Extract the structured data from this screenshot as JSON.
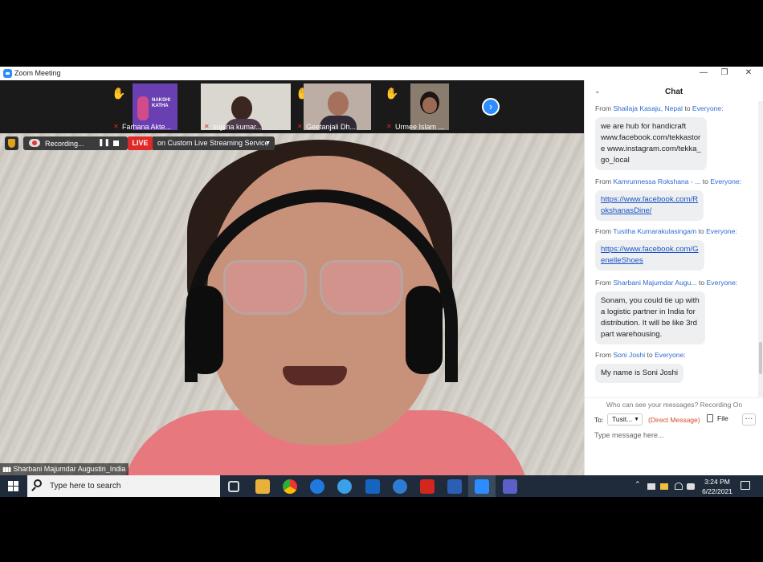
{
  "window": {
    "title": "Zoom Meeting",
    "minimize": "—",
    "restore": "❐",
    "close": "✕"
  },
  "participants": [
    {
      "name": "Farhana Akte...",
      "hand": "✋",
      "thumb_color": "#6a3fb2"
    },
    {
      "name": "sujana kumar...",
      "hand": "✋",
      "thumb_color": "#dad6d0"
    },
    {
      "name": "Geetanjali Dh...",
      "hand": "✋",
      "thumb_color": "#bcaea5"
    },
    {
      "name": "Urmee Islam ...",
      "hand": "✋",
      "thumb_color": "#8a7d70"
    }
  ],
  "participant_thumb_text": [
    "NAKSHI",
    "KATHA"
  ],
  "next_label": "›",
  "recording": {
    "label": "Recording...",
    "pause": "❚❚"
  },
  "live": {
    "badge": "LIVE",
    "service": "on Custom Live Streaming Service",
    "caret": "▼"
  },
  "speaker": {
    "name": "Sharbani Majumdar Augustin_India",
    "signal": "▮▮▮"
  },
  "chat": {
    "title": "Chat",
    "collapse": "⌄",
    "messages": [
      {
        "from": "Shailaja Kasaju, Nepal",
        "to": "Everyone:",
        "lines": [
          "we are hub for handicraft",
          "www.facebook.com/tekkastor",
          "e www.instagram.com/tekka_",
          "go_local"
        ],
        "link": false
      },
      {
        "from": "Kamrunnessa Rokshana - ...",
        "to": "Everyone:",
        "lines": [
          "https://www.facebook.com/R",
          "okshanasDine/"
        ],
        "link": true
      },
      {
        "from": "Tusitha Kumarakulasingam",
        "to": "Everyone:",
        "lines": [
          "https://www.facebook.com/G",
          "enelleShoes"
        ],
        "link": true
      },
      {
        "from": "Sharbani Majumdar Augu...",
        "to": "Everyone:",
        "lines": [
          "Sonam, you could tie up with",
          "a logistic partner in India for",
          "distribution. It will be like 3rd",
          "part warehousing."
        ],
        "link": false
      },
      {
        "from": "Soni Joshi",
        "to": "Everyone:",
        "lines": [
          "My name is Soni Joshi"
        ],
        "link": false
      }
    ],
    "from_word": "From",
    "to_word": "to",
    "visibility": "Who can see your messages? Recording On",
    "to_label": "To:",
    "recipient": "Tusit...",
    "direct": "(Direct Message)",
    "file": "File",
    "more": "···",
    "input_placeholder": "Type message here..."
  },
  "taskbar": {
    "search_placeholder": "Type here to search",
    "time": "3:24 PM",
    "date": "6/22/2021",
    "tray_up": "⌃"
  },
  "colors": {
    "accent": "#2d8cff",
    "live": "#e02828",
    "taskbar": "#1f2b3a",
    "link": "#2d6bd1"
  }
}
